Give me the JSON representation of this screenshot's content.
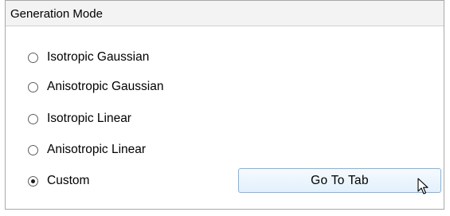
{
  "group": {
    "title": "Generation Mode"
  },
  "options": [
    {
      "label": "Isotropic Gaussian",
      "selected": false
    },
    {
      "label": "Anisotropic Gaussian",
      "selected": false
    },
    {
      "label": "Isotropic Linear",
      "selected": false
    },
    {
      "label": "Anisotropic Linear",
      "selected": false
    },
    {
      "label": "Custom",
      "selected": true
    }
  ],
  "go_to_tab": {
    "label": "Go To Tab"
  },
  "colors": {
    "button_border": "#7eb4ea",
    "button_fill": "#e3f0fc",
    "header_fill": "#f3f3f3"
  },
  "icons": {
    "cursor": "arrow-pointer-icon"
  }
}
